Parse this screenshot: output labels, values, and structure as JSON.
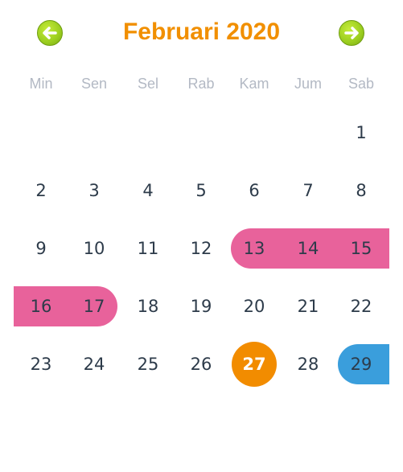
{
  "header": {
    "title": "Februari 2020",
    "prev_icon": "arrow-left-icon",
    "next_icon": "arrow-right-icon"
  },
  "weekdays": [
    "Min",
    "Sen",
    "Sel",
    "Rab",
    "Kam",
    "Jum",
    "Sab"
  ],
  "month": {
    "first_weekday_index": 6,
    "days": [
      "1",
      "2",
      "3",
      "4",
      "5",
      "6",
      "7",
      "8",
      "9",
      "10",
      "11",
      "12",
      "13",
      "14",
      "15",
      "16",
      "17",
      "18",
      "19",
      "20",
      "21",
      "22",
      "23",
      "24",
      "25",
      "26",
      "27",
      "28",
      "29"
    ]
  },
  "highlights": {
    "range_days": [
      "13",
      "14",
      "15",
      "16",
      "17"
    ],
    "today": "27",
    "selected": "29"
  },
  "colors": {
    "range": "#e8629b",
    "today": "#f28c00",
    "selected": "#3a9edc",
    "title": "#f18f00",
    "nav_button": "#9acd1f"
  }
}
